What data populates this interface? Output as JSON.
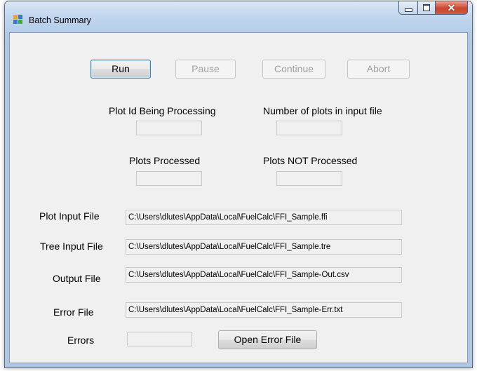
{
  "window": {
    "title": "Batch Summary"
  },
  "buttons": {
    "run": "Run",
    "pause": "Pause",
    "continue": "Continue",
    "abort": "Abort",
    "open_error_file": "Open Error File"
  },
  "stats": {
    "plot_id_label": "Plot Id Being Processing",
    "num_plots_label": "Number of plots in input file",
    "processed_label": "Plots Processed",
    "not_processed_label": "Plots NOT Processed"
  },
  "files": {
    "plot_input_label": "Plot Input File",
    "plot_input_value": "C:\\Users\\dlutes\\AppData\\Local\\FuelCalc\\FFI_Sample.ffi",
    "tree_input_label": "Tree Input File",
    "tree_input_value": "C:\\Users\\dlutes\\AppData\\Local\\FuelCalc\\FFI_Sample.tre",
    "output_label": "Output File",
    "output_value": "C:\\Users\\dlutes\\AppData\\Local\\FuelCalc\\FFI_Sample-Out.csv",
    "error_label": "Error File",
    "error_value": "C:\\Users\\dlutes\\AppData\\Local\\FuelCalc\\FFI_Sample-Err.txt",
    "errors_label": "Errors"
  },
  "colors": {
    "titlebar": "#c3d7ef",
    "client": "#f0f0f0",
    "close": "#c9452d"
  }
}
